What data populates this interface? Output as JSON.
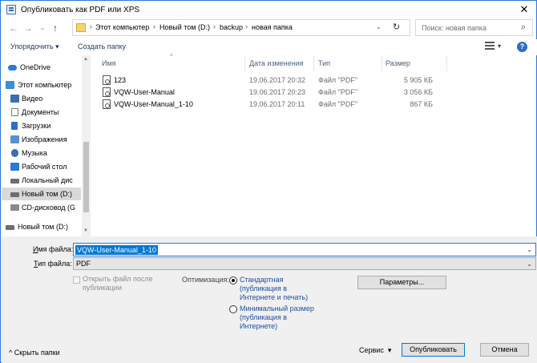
{
  "window": {
    "title": "Опубликовать как PDF или XPS",
    "close_glyph": "✕"
  },
  "address": {
    "back_glyph": "←",
    "forward_glyph": "→",
    "up_glyph": "↑",
    "separator": "›",
    "crumbs": [
      "Этот компьютер",
      "Новый том (D:)",
      "backup",
      "новая папка"
    ],
    "dropdown_glyph": "⌄",
    "refresh_glyph": "↻"
  },
  "search": {
    "placeholder": "Поиск: новая папка",
    "icon_glyph": "⌕"
  },
  "toolbar": {
    "organize": "Упорядочить",
    "organize_arrow": "▾",
    "new_folder": "Создать папку",
    "view_drop": "▾",
    "help": "?"
  },
  "nav": {
    "items": [
      {
        "label": "OneDrive",
        "icon": "cloud-icon",
        "color": "#2b79d8"
      },
      {
        "label": "Этот компьютер",
        "icon": "computer-icon",
        "color": "#3a8ed4"
      },
      {
        "label": "Видео",
        "icon": "video-icon",
        "color": "#3a6fb0"
      },
      {
        "label": "Документы",
        "icon": "documents-icon",
        "color": "#8a8a8a"
      },
      {
        "label": "Загрузки",
        "icon": "downloads-icon",
        "color": "#2f6cc9"
      },
      {
        "label": "Изображения",
        "icon": "pictures-icon",
        "color": "#5b8fd0"
      },
      {
        "label": "Музыка",
        "icon": "music-icon",
        "color": "#3a6fb0"
      },
      {
        "label": "Рабочий стол",
        "icon": "desktop-icon",
        "color": "#2b79d8"
      },
      {
        "label": "Локальный дис",
        "icon": "drive-icon",
        "color": "#6d6d6d"
      },
      {
        "label": "Новый том (D:)",
        "icon": "drive-icon",
        "color": "#6d6d6d"
      },
      {
        "label": "CD-дисковод (G",
        "icon": "cd-drive-icon",
        "color": "#8a8a8a"
      },
      {
        "label": "Новый том (D:)",
        "icon": "drive-icon",
        "color": "#6d6d6d"
      }
    ]
  },
  "files": {
    "columns": [
      "Имя",
      "Дата изменения",
      "Тип",
      "Размер"
    ],
    "sort_glyph": "^",
    "rows": [
      {
        "name": "123",
        "date": "19.06.2017 20:32",
        "type": "Файл \"PDF\"",
        "size": "5 905 КБ"
      },
      {
        "name": "VQW-User-Manual",
        "date": "19.06.2017 20:23",
        "type": "Файл \"PDF\"",
        "size": "3 056 КБ"
      },
      {
        "name": "VQW-User-Manual_1-10",
        "date": "19.06.2017 20:11",
        "type": "Файл \"PDF\"",
        "size": "867 КБ"
      }
    ]
  },
  "form": {
    "filename_label_u": "И",
    "filename_label_rest": "мя файла:",
    "filename_value": "VQW-User-Manual_1-10",
    "filetype_label_u": "Т",
    "filetype_label_rest": "ип файла:",
    "filetype_value": "PDF",
    "open_after": "Открыть файл после публикации",
    "optimization_label": "Оптимизация:",
    "standard_option": "Стандартная (публикация в Интернете и печать)",
    "minimal_option": "Минимальный размер (публикация в Интернете)",
    "params_button": "Параметры...",
    "hide_folders": "Скрыть папки",
    "hide_glyph": "^",
    "service": "Сервис",
    "service_arrow": "▾",
    "publish_button": "Опубликовать",
    "cancel_button": "Отмена"
  }
}
